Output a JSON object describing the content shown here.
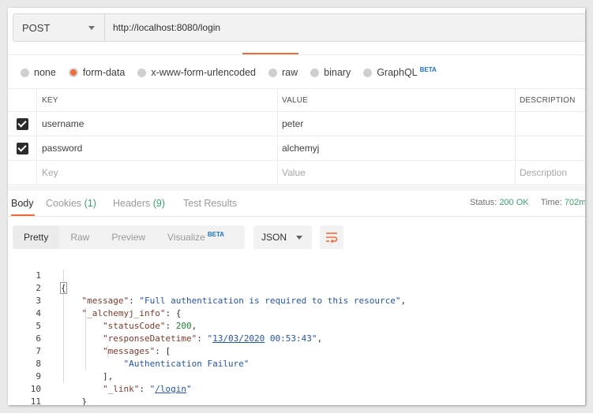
{
  "request": {
    "method": "POST",
    "url": "http://localhost:8080/login"
  },
  "body_types": [
    {
      "label": "none",
      "checked": false,
      "beta": ""
    },
    {
      "label": "form-data",
      "checked": true,
      "beta": ""
    },
    {
      "label": "x-www-form-urlencoded",
      "checked": false,
      "beta": ""
    },
    {
      "label": "raw",
      "checked": false,
      "beta": ""
    },
    {
      "label": "binary",
      "checked": false,
      "beta": ""
    },
    {
      "label": "GraphQL",
      "checked": false,
      "beta": "BETA"
    }
  ],
  "params": {
    "headers": {
      "key": "KEY",
      "value": "VALUE",
      "description": "DESCRIPTION"
    },
    "rows": [
      {
        "key": "username",
        "value": "peter",
        "checked": true
      },
      {
        "key": "password",
        "value": "alchemyj",
        "checked": true
      }
    ],
    "placeholders": {
      "key": "Key",
      "value": "Value",
      "description": "Description"
    }
  },
  "response": {
    "tabs": {
      "body": "Body",
      "cookies": "Cookies",
      "cookies_count": "(1)",
      "headers": "Headers",
      "headers_count": "(9)",
      "tests": "Test Results"
    },
    "status_label": "Status:",
    "status_value": "200 OK",
    "time_label": "Time:",
    "time_value": "702m"
  },
  "view_modes": {
    "pretty": "Pretty",
    "raw": "Raw",
    "preview": "Preview",
    "visualize": "Visualize",
    "visualize_badge": "BETA",
    "format": "JSON"
  },
  "code_lines": [
    "1",
    "2",
    "3",
    "4",
    "5",
    "6",
    "7",
    "8",
    "9",
    "10",
    "11"
  ],
  "json": {
    "message_key": "\"message\"",
    "message_value": "\"Full authentication is required to this resource\"",
    "info_key": "\"_alchemyj_info\"",
    "status_code_key": "\"statusCode\"",
    "status_code_value": "200",
    "datetime_key": "\"responseDatetime\"",
    "datetime_q1": "\"",
    "datetime_date": "13/03/2020",
    "datetime_rest": " 00:53:43\"",
    "messages_key": "\"messages\"",
    "messages_item": "\"Authentication Failure\"",
    "link_key": "\"_link\"",
    "link_q1": "\"",
    "link_path": "/login",
    "link_q2": "\""
  },
  "colors": {
    "accent": "#f26b3a",
    "status_ok": "#3aa36b",
    "json_key": "#803a2a",
    "json_string": "#2353b3",
    "json_number": "#1a7f37"
  }
}
